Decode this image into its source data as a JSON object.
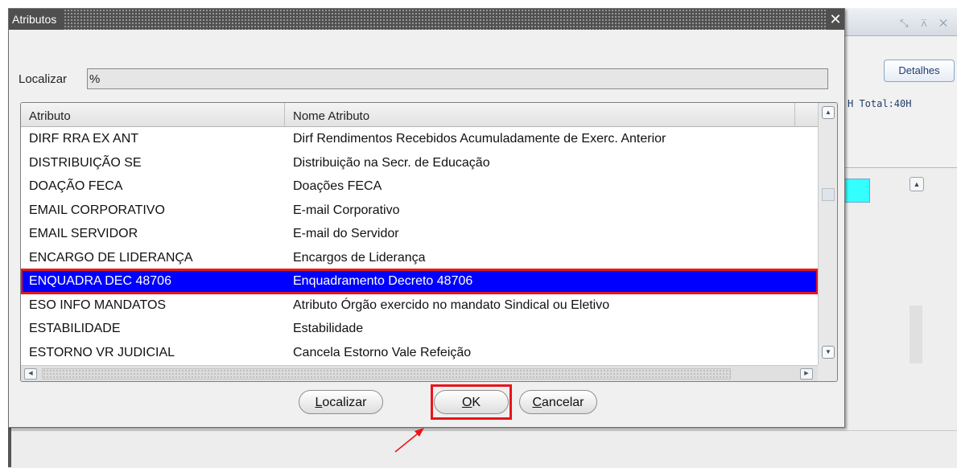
{
  "dialog": {
    "title": "Atributos",
    "close_glyph": "✕",
    "search": {
      "label": "Localizar",
      "value": "%"
    },
    "columns": [
      "Atributo",
      "Nome Atributo"
    ],
    "rows": [
      {
        "atributo": "DIRF RRA EX ANT",
        "nome": "Dirf Rendimentos Recebidos Acumuladamente de Exerc. Anterior"
      },
      {
        "atributo": "DISTRIBUIÇÃO SE",
        "nome": "Distribuição na Secr. de Educação"
      },
      {
        "atributo": "DOAÇÃO FECA",
        "nome": "Doações FECA"
      },
      {
        "atributo": "EMAIL CORPORATIVO",
        "nome": "E-mail Corporativo"
      },
      {
        "atributo": "EMAIL SERVIDOR",
        "nome": "E-mail do Servidor"
      },
      {
        "atributo": "ENCARGO DE LIDERANÇA",
        "nome": "Encargos de Liderança"
      },
      {
        "atributo": "ENQUADRA DEC 48706",
        "nome": "Enquadramento Decreto 48706",
        "selected": true
      },
      {
        "atributo": "ESO INFO MANDATOS",
        "nome": "Atributo Órgão exercido no mandato Sindical ou Eletivo"
      },
      {
        "atributo": "ESTABILIDADE",
        "nome": "Estabilidade"
      },
      {
        "atributo": "ESTORNO VR JUDICIAL",
        "nome": "Cancela Estorno Vale Refeição"
      }
    ],
    "buttons": {
      "find": {
        "mnemonic": "L",
        "rest": "ocalizar"
      },
      "ok": {
        "mnemonic": "O",
        "rest": "K"
      },
      "cancel": {
        "mnemonic": "C",
        "rest": "ancelar"
      }
    }
  },
  "background": {
    "detalhes_label": "Detalhes",
    "total_text": "H Total:40H"
  },
  "colors": {
    "selection": "#0000ff",
    "highlight": "#e8141a",
    "titlebar": "#4f4f4f",
    "cyan_cell": "#33ffff"
  }
}
